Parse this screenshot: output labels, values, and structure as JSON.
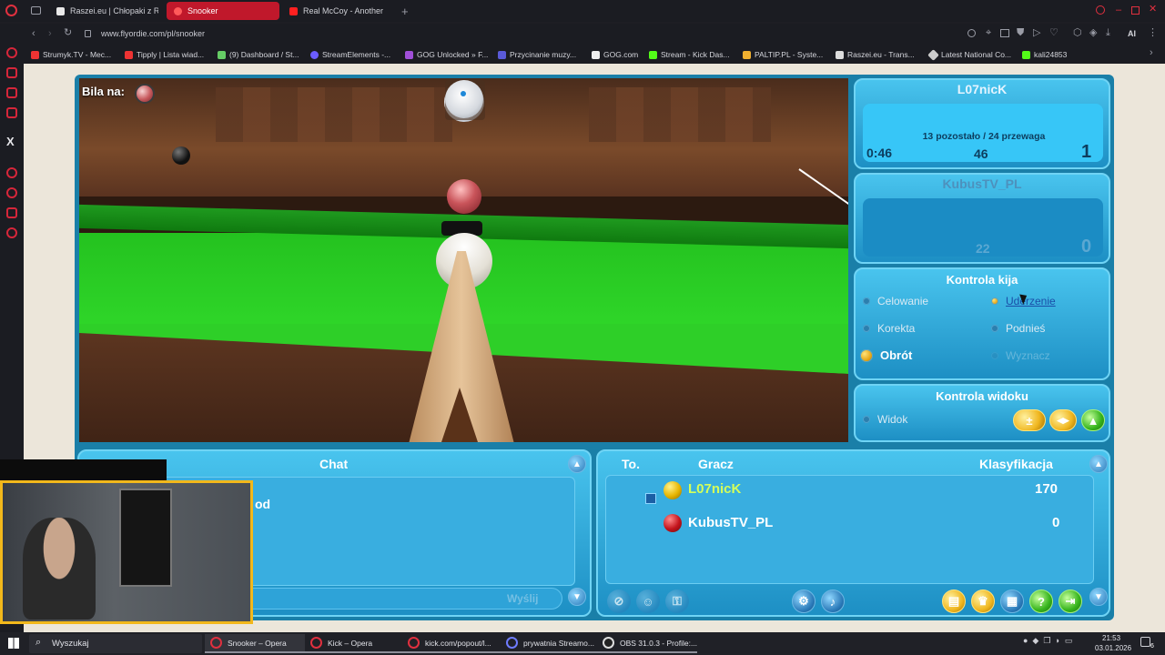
{
  "browser": {
    "tabs": [
      {
        "label": "Raszei.eu | Chłopaki z Ras",
        "active": false
      },
      {
        "label": "Snooker",
        "active": true
      },
      {
        "label": "Real McCoy - Another",
        "active": false
      }
    ],
    "new_tab_glyph": "+",
    "url": "www.flyordie.com/pl/snooker",
    "bookmarks": [
      "Strumyk.TV - Mec...",
      "Tipply | Lista wiad...",
      "(9) Dashboard / St...",
      "StreamElements -...",
      "GOG Unlocked » F...",
      "Przycinanie muzy...",
      "GOG.com",
      "Stream - Kick Das...",
      "PALTIP.PL - Syste...",
      "Raszei.eu - Trans...",
      "Latest National Co...",
      "kali24853"
    ],
    "ai_label": "AI",
    "sidebar_x": "X"
  },
  "game": {
    "bila_label": "Bila na:",
    "player1": {
      "name": "L07nicK",
      "info": "13 pozostało / 24 przewaga",
      "timer": "0:46",
      "break": "46",
      "frames": "1"
    },
    "player2": {
      "name": "KubusTV_PL",
      "break": "22",
      "frames": "0"
    },
    "cue_control": {
      "title": "Kontrola kija",
      "items": [
        {
          "label": "Celowanie",
          "state": "off"
        },
        {
          "label": "Uderzenie",
          "state": "link"
        },
        {
          "label": "Korekta",
          "state": "off"
        },
        {
          "label": "Podnieś",
          "state": "off"
        },
        {
          "label": "Obrót",
          "state": "on"
        },
        {
          "label": "Wyznacz",
          "state": "disabled"
        }
      ]
    },
    "view_control": {
      "title": "Kontrola widoku",
      "item": "Widok"
    },
    "chat": {
      "title": "Chat",
      "partial_text": "od",
      "send_label": "Wyślij"
    },
    "scoreboard": {
      "headers": {
        "pos": "To.",
        "player": "Gracz",
        "rank": "Klasyfikacja"
      },
      "rows": [
        {
          "name": "L07nicK",
          "score": "170",
          "ball_color": "#e6b400",
          "name_color": "#d4ff5a"
        },
        {
          "name": "KubusTV_PL",
          "score": "0",
          "ball_color": "#c4141c",
          "name_color": "#ffffff"
        }
      ]
    }
  },
  "taskbar": {
    "search": "Wyszukaj",
    "apps": [
      "Snooker – Opera",
      "Kick – Opera",
      "kick.com/popout/l...",
      "prywatnia Streamo...",
      "OBS 31.0.3 - Profile:..."
    ],
    "time": "21:53",
    "date": "03.01.2026",
    "notif_count": "6"
  },
  "colors": {
    "opera_red": "#c0182b",
    "panel_blue": "#1d8fc4",
    "table_green": "#2fd629"
  }
}
